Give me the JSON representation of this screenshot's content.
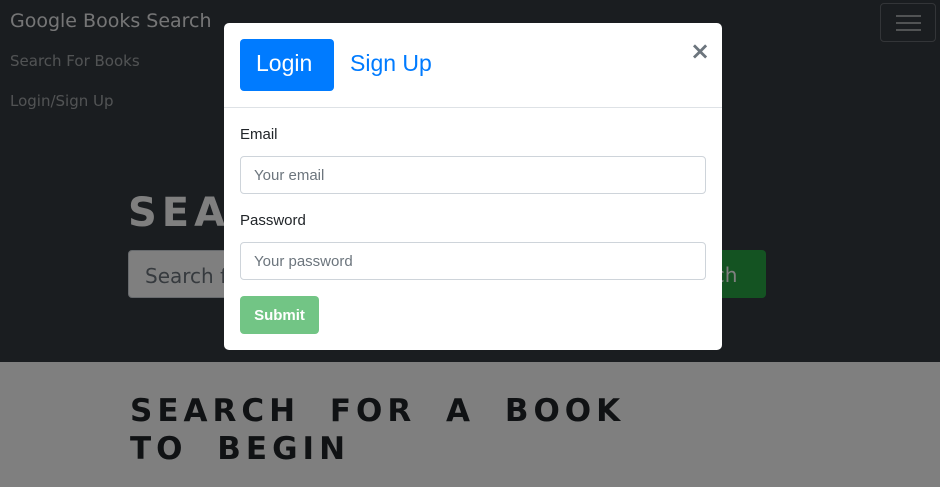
{
  "navbar": {
    "brand": "Google Books Search",
    "links": [
      "Search For Books",
      "Login/Sign Up"
    ]
  },
  "hero": {
    "title": "SEA",
    "search_placeholder": "Search f",
    "search_button": "rch"
  },
  "results": {
    "heading": "SEARCH FOR A BOOK TO BEGIN"
  },
  "modal": {
    "tabs": [
      "Login",
      "Sign Up"
    ],
    "close": "×",
    "email_label": "Email",
    "email_placeholder": "Your email",
    "password_label": "Password",
    "password_placeholder": "Your password",
    "submit": "Submit"
  },
  "colors": {
    "primary": "#007bff",
    "success": "#28a745",
    "navbar": "#343a40"
  }
}
